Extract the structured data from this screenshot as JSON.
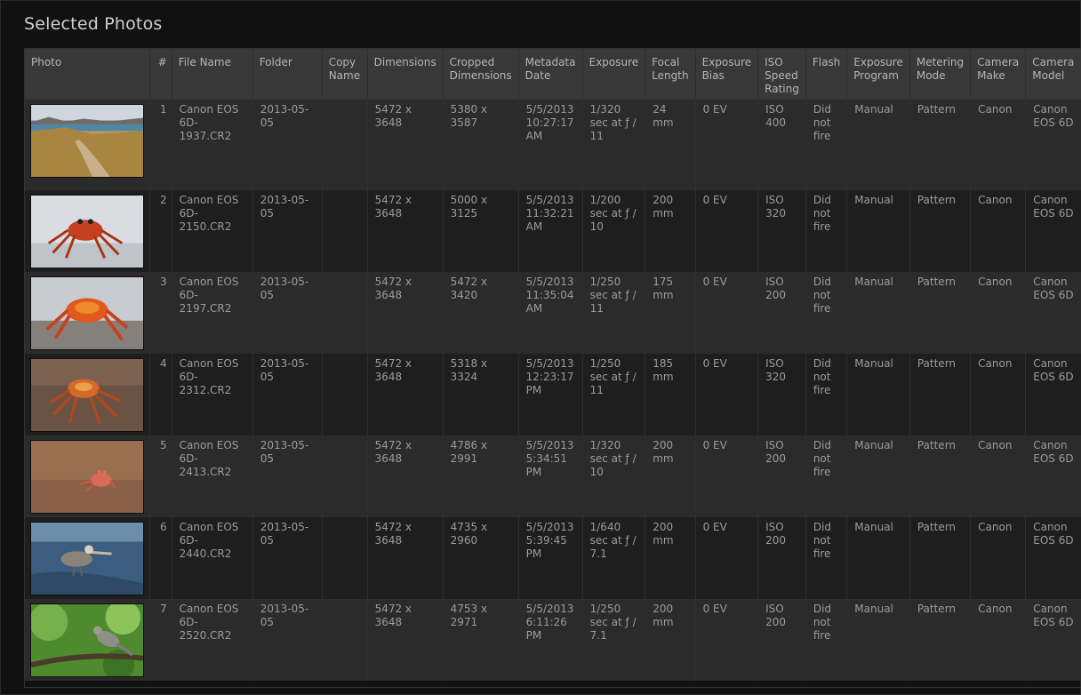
{
  "page": {
    "title": "Selected Photos"
  },
  "columns": [
    "Photo",
    "#",
    "File Name",
    "Folder",
    "Copy Name",
    "Dimensions",
    "Cropped Dimensions",
    "Metadata Date",
    "Exposure",
    "Focal Length",
    "Exposure Bias",
    "ISO Speed Rating",
    "Flash",
    "Exposure Program",
    "Metering Mode",
    "Camera Make",
    "Camera Model"
  ],
  "rows": [
    {
      "num": "1",
      "file": "Canon EOS 6D-1937.CR2",
      "folder": "2013-05-05",
      "copy": "",
      "dim": "5472 x 3648",
      "crop": "5380 x 3587",
      "date": "5/5/2013 10:27:17 AM",
      "exposure": "1/320 sec at ƒ / 11",
      "focal": "24 mm",
      "bias": "0 EV",
      "iso": "ISO 400",
      "flash": "Did not fire",
      "program": "Manual",
      "metering": "Pattern",
      "make": "Canon",
      "model": "Canon EOS 6D",
      "thumb": "landscape"
    },
    {
      "num": "2",
      "file": "Canon EOS 6D-2150.CR2",
      "folder": "2013-05-05",
      "copy": "",
      "dim": "5472 x 3648",
      "crop": "5000 x 3125",
      "date": "5/5/2013 11:32:21 AM",
      "exposure": "1/200 sec at ƒ / 10",
      "focal": "200 mm",
      "bias": "0 EV",
      "iso": "ISO 320",
      "flash": "Did not fire",
      "program": "Manual",
      "metering": "Pattern",
      "make": "Canon",
      "model": "Canon EOS 6D",
      "thumb": "crab-light"
    },
    {
      "num": "3",
      "file": "Canon EOS 6D-2197.CR2",
      "folder": "2013-05-05",
      "copy": "",
      "dim": "5472 x 3648",
      "crop": "5472 x 3420",
      "date": "5/5/2013 11:35:04 AM",
      "exposure": "1/250 sec at ƒ / 11",
      "focal": "175 mm",
      "bias": "0 EV",
      "iso": "ISO 200",
      "flash": "Did not fire",
      "program": "Manual",
      "metering": "Pattern",
      "make": "Canon",
      "model": "Canon EOS 6D",
      "thumb": "crab-orange"
    },
    {
      "num": "4",
      "file": "Canon EOS 6D-2312.CR2",
      "folder": "2013-05-05",
      "copy": "",
      "dim": "5472 x 3648",
      "crop": "5318 x 3324",
      "date": "5/5/2013 12:23:17 PM",
      "exposure": "1/250 sec at ƒ / 11",
      "focal": "185 mm",
      "bias": "0 EV",
      "iso": "ISO 320",
      "flash": "Did not fire",
      "program": "Manual",
      "metering": "Pattern",
      "make": "Canon",
      "model": "Canon EOS 6D",
      "thumb": "crab-brown"
    },
    {
      "num": "5",
      "file": "Canon EOS 6D-2413.CR2",
      "folder": "2013-05-05",
      "copy": "",
      "dim": "5472 x 3648",
      "crop": "4786 x 2991",
      "date": "5/5/2013 5:34:51 PM",
      "exposure": "1/320 sec at ƒ / 10",
      "focal": "200 mm",
      "bias": "0 EV",
      "iso": "ISO 200",
      "flash": "Did not fire",
      "program": "Manual",
      "metering": "Pattern",
      "make": "Canon",
      "model": "Canon EOS 6D",
      "thumb": "ghost-crab"
    },
    {
      "num": "6",
      "file": "Canon EOS 6D-2440.CR2",
      "folder": "2013-05-05",
      "copy": "",
      "dim": "5472 x 3648",
      "crop": "4735 x 2960",
      "date": "5/5/2013 5:39:45 PM",
      "exposure": "1/640 sec at ƒ / 7.1",
      "focal": "200 mm",
      "bias": "0 EV",
      "iso": "ISO 200",
      "flash": "Did not fire",
      "program": "Manual",
      "metering": "Pattern",
      "make": "Canon",
      "model": "Canon EOS 6D",
      "thumb": "pelican"
    },
    {
      "num": "7",
      "file": "Canon EOS 6D-2520.CR2",
      "folder": "2013-05-05",
      "copy": "",
      "dim": "5472 x 3648",
      "crop": "4753 x 2971",
      "date": "5/5/2013 6:11:26 PM",
      "exposure": "1/250 sec at ƒ / 7.1",
      "focal": "200 mm",
      "bias": "0 EV",
      "iso": "ISO 200",
      "flash": "Did not fire",
      "program": "Manual",
      "metering": "Pattern",
      "make": "Canon",
      "model": "Canon EOS 6D",
      "thumb": "mockingbird"
    }
  ]
}
